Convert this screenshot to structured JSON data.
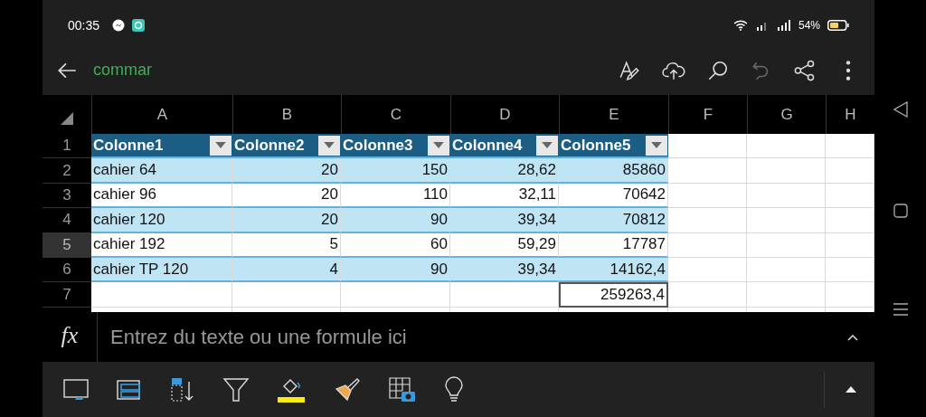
{
  "status_bar": {
    "time": "00:35",
    "battery": "54%"
  },
  "app_bar": {
    "title": "commar"
  },
  "sheet": {
    "columns": [
      "A",
      "B",
      "C",
      "D",
      "E",
      "F",
      "G",
      "H"
    ],
    "rows": [
      {
        "number": "1",
        "highlighted": false,
        "kind": "table",
        "cells": [
          {
            "text": "Colonne1",
            "kind": "header",
            "selected": false
          },
          {
            "text": "Colonne2",
            "kind": "header",
            "selected": false
          },
          {
            "text": "Colonne3",
            "kind": "header",
            "selected": false
          },
          {
            "text": "Colonne4",
            "kind": "header",
            "selected": false
          },
          {
            "text": "Colonne5",
            "kind": "header",
            "selected": false
          }
        ]
      },
      {
        "number": "2",
        "highlighted": false,
        "kind": "table",
        "banded": true,
        "cells": [
          {
            "text": "cahier 64",
            "kind": "text",
            "selected": false
          },
          {
            "text": "20",
            "kind": "number",
            "selected": false
          },
          {
            "text": "150",
            "kind": "number",
            "selected": false
          },
          {
            "text": "28,62",
            "kind": "number",
            "selected": false
          },
          {
            "text": "85860",
            "kind": "number",
            "selected": false
          }
        ]
      },
      {
        "number": "3",
        "highlighted": false,
        "kind": "table",
        "banded": false,
        "cells": [
          {
            "text": "cahier 96",
            "kind": "text",
            "selected": false
          },
          {
            "text": "20",
            "kind": "number",
            "selected": false
          },
          {
            "text": "110",
            "kind": "number",
            "selected": false
          },
          {
            "text": "32,11",
            "kind": "number",
            "selected": false
          },
          {
            "text": "70642",
            "kind": "number",
            "selected": false
          }
        ]
      },
      {
        "number": "4",
        "highlighted": false,
        "kind": "table",
        "banded": true,
        "cells": [
          {
            "text": "cahier 120",
            "kind": "text",
            "selected": false
          },
          {
            "text": "20",
            "kind": "number",
            "selected": false
          },
          {
            "text": "90",
            "kind": "number",
            "selected": false
          },
          {
            "text": "39,34",
            "kind": "number",
            "selected": false
          },
          {
            "text": "70812",
            "kind": "number",
            "selected": false
          }
        ]
      },
      {
        "number": "5",
        "highlighted": true,
        "kind": "table",
        "banded": false,
        "cells": [
          {
            "text": "cahier 192",
            "kind": "text",
            "selected": false
          },
          {
            "text": "5",
            "kind": "number",
            "selected": false
          },
          {
            "text": "60",
            "kind": "number",
            "selected": false
          },
          {
            "text": "59,29",
            "kind": "number",
            "selected": false
          },
          {
            "text": "17787",
            "kind": "number",
            "selected": false
          }
        ]
      },
      {
        "number": "6",
        "highlighted": false,
        "kind": "table",
        "banded": true,
        "cells": [
          {
            "text": "cahier TP 120",
            "kind": "text",
            "selected": false
          },
          {
            "text": "4",
            "kind": "number",
            "selected": false
          },
          {
            "text": "90",
            "kind": "number",
            "selected": false
          },
          {
            "text": "39,34",
            "kind": "number",
            "selected": false
          },
          {
            "text": "14162,4",
            "kind": "number",
            "selected": false
          }
        ]
      },
      {
        "number": "7",
        "highlighted": false,
        "kind": "plain",
        "cells": [
          {
            "selected": false
          },
          {
            "selected": false
          },
          {
            "selected": false
          },
          {
            "selected": false
          },
          {
            "text": "259263,4",
            "kind": "number",
            "selected": true
          }
        ]
      }
    ]
  },
  "formula_bar": {
    "label": "fx",
    "placeholder": "Entrez du texte ou une formule ici"
  }
}
